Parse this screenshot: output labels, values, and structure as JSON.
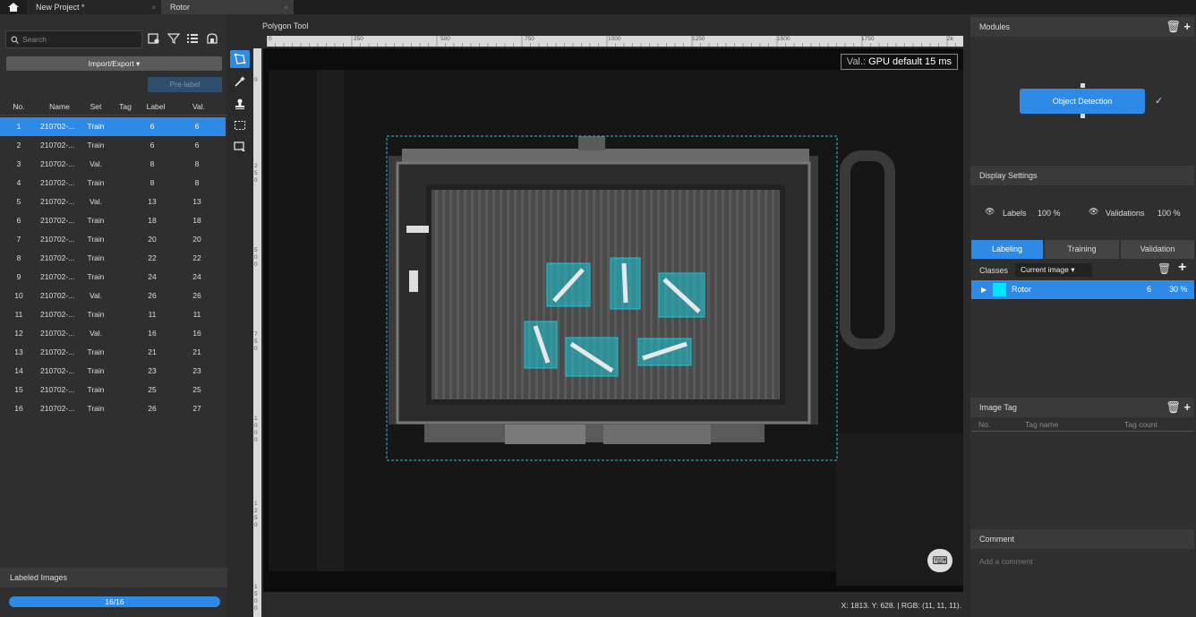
{
  "titlebar": {
    "tabs": [
      {
        "label": "New Project *",
        "close": "×"
      },
      {
        "label": "Rotor",
        "close": "×"
      }
    ]
  },
  "left": {
    "search_placeholder": "Search",
    "import_export": "Import/Export ▾",
    "prelabel": "Pre-label",
    "columns": [
      "No.",
      "Name",
      "Set",
      "Tag",
      "Label",
      "Val."
    ],
    "rows": [
      {
        "no": "1",
        "name": "210702-...",
        "set": "Train",
        "tag": "",
        "label": "6",
        "val": "6",
        "selected": true
      },
      {
        "no": "2",
        "name": "210702-...",
        "set": "Train",
        "tag": "",
        "label": "6",
        "val": "6"
      },
      {
        "no": "3",
        "name": "210702-...",
        "set": "Val.",
        "tag": "",
        "label": "8",
        "val": "8"
      },
      {
        "no": "4",
        "name": "210702-...",
        "set": "Train",
        "tag": "",
        "label": "8",
        "val": "8"
      },
      {
        "no": "5",
        "name": "210702-...",
        "set": "Val.",
        "tag": "",
        "label": "13",
        "val": "13"
      },
      {
        "no": "6",
        "name": "210702-...",
        "set": "Train",
        "tag": "",
        "label": "18",
        "val": "18"
      },
      {
        "no": "7",
        "name": "210702-...",
        "set": "Train",
        "tag": "",
        "label": "20",
        "val": "20"
      },
      {
        "no": "8",
        "name": "210702-...",
        "set": "Train",
        "tag": "",
        "label": "22",
        "val": "22"
      },
      {
        "no": "9",
        "name": "210702-...",
        "set": "Train",
        "tag": "",
        "label": "24",
        "val": "24"
      },
      {
        "no": "10",
        "name": "210702-...",
        "set": "Val.",
        "tag": "",
        "label": "26",
        "val": "26"
      },
      {
        "no": "11",
        "name": "210702-...",
        "set": "Train",
        "tag": "",
        "label": "11",
        "val": "11"
      },
      {
        "no": "12",
        "name": "210702-...",
        "set": "Val.",
        "tag": "",
        "label": "16",
        "val": "16"
      },
      {
        "no": "13",
        "name": "210702-...",
        "set": "Train",
        "tag": "",
        "label": "21",
        "val": "21"
      },
      {
        "no": "14",
        "name": "210702-...",
        "set": "Train",
        "tag": "",
        "label": "23",
        "val": "23"
      },
      {
        "no": "15",
        "name": "210702-...",
        "set": "Train",
        "tag": "",
        "label": "25",
        "val": "25"
      },
      {
        "no": "16",
        "name": "210702-...",
        "set": "Train",
        "tag": "",
        "label": "26",
        "val": "27"
      }
    ],
    "labeled_images_title": "Labeled Images",
    "labeled_progress": "16/16",
    "labeled_fraction": 1.0
  },
  "canvas": {
    "tool_title": "Polygon Tool",
    "ruler_ticks": [
      "0",
      "250",
      "500",
      "750",
      "1000",
      "1250",
      "1500",
      "1750",
      "2k"
    ],
    "ruler_left_ticks": [
      "0",
      "250",
      "500",
      "750",
      "1000",
      "1250",
      "1500"
    ],
    "val_label": "Val.:",
    "val_value": "GPU default 15 ms",
    "coord_readout": "X: 1813. Y: 628. | RGB: (11, 11, 11)."
  },
  "right": {
    "modules_title": "Modules",
    "module_name": "Object Detection",
    "module_status": "✓",
    "display_settings_title": "Display Settings",
    "labels_label": "Labels",
    "labels_value": "100 %",
    "validations_label": "Validations",
    "validations_value": "100 %",
    "tabs": [
      "Labeling",
      "Training",
      "Validation"
    ],
    "classes_label": "Classes",
    "classes_filter": "Current image ▾",
    "classes": [
      {
        "name": "Rotor",
        "count": "6",
        "percent": "30 %",
        "color": "#00e5ff"
      }
    ],
    "image_tag_title": "Image Tag",
    "tag_columns": [
      "No.",
      "Tag name",
      "Tag count"
    ],
    "comment_title": "Comment",
    "comment_placeholder": "Add a comment"
  },
  "colors": {
    "accent": "#2d8ae6",
    "label_box": "#19c6d6"
  }
}
